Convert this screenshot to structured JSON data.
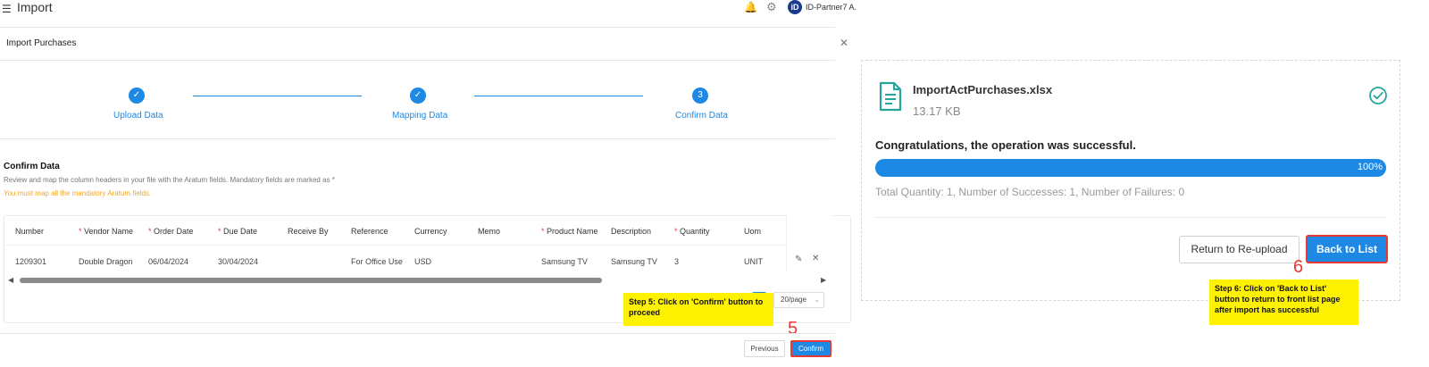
{
  "app": {
    "title": "Import",
    "org_name": "ID-Partner7 A.",
    "logo_text": "iD"
  },
  "icons": {
    "menu": "☰",
    "bell": "🔔",
    "gear": "⚙",
    "close": "✕",
    "check": "✓",
    "edit": "✎",
    "delete": "✕",
    "arrow_left": "◀",
    "arrow_right": "▶",
    "chevron_down": "⌄"
  },
  "modal": {
    "title": "Import Purchases"
  },
  "stepper": {
    "steps": [
      {
        "label": "Upload Data",
        "status": "done"
      },
      {
        "label": "Mapping Data",
        "status": "done"
      },
      {
        "label": "Confirm Data",
        "status": "current",
        "number": "3"
      }
    ]
  },
  "confirm_section": {
    "heading": "Confirm Data",
    "description": "Review and map the column headers in your file with the Aratum fields. Mandatory fields are marked as *",
    "warning": "You must map all the mandatory Aratum fields."
  },
  "table": {
    "required_marker": "*",
    "columns": [
      {
        "label": "Number",
        "required": false
      },
      {
        "label": "Vendor Name",
        "required": true
      },
      {
        "label": "Order Date",
        "required": true
      },
      {
        "label": "Due Date",
        "required": true
      },
      {
        "label": "Receive By",
        "required": false
      },
      {
        "label": "Reference",
        "required": false
      },
      {
        "label": "Currency",
        "required": false
      },
      {
        "label": "Memo",
        "required": false
      },
      {
        "label": "Product Name",
        "required": true
      },
      {
        "label": "Description",
        "required": false
      },
      {
        "label": "Quantity",
        "required": true
      },
      {
        "label": "Uom",
        "required": false
      }
    ],
    "rows": [
      [
        "1209301",
        "Double Dragon",
        "06/04/2024",
        "30/04/2024",
        "",
        "For Office Use",
        "USD",
        "",
        "Samsung TV",
        "Samsung TV",
        "3",
        "UNIT"
      ]
    ],
    "page_size": "20/page"
  },
  "footer": {
    "previous_label": "Previous",
    "confirm_label": "Confirm"
  },
  "annotations": {
    "step5_text": "Step 5: Click on 'Confirm' button to proceed",
    "step5_number": "5",
    "step6_text": "Step 6: Click on 'Back to List' button to return to front list page after import has successful",
    "step6_number": "6"
  },
  "result": {
    "file_name": "ImportActPurchases.xlsx",
    "file_size": "13.17 KB",
    "message": "Congratulations, the operation was successful.",
    "progress": 100,
    "progress_label": "100%",
    "summary": "Total Quantity: 1, Number of Successes: 1, Number of Failures: 0",
    "reupload_label": "Return to Re-upload",
    "back_label": "Back to List"
  },
  "colors": {
    "primary": "#1e88e5",
    "required": "#e53935",
    "warning": "#f5a623",
    "success": "#26a69a",
    "callout": "#fff200",
    "highlight_border": "#e53935"
  }
}
